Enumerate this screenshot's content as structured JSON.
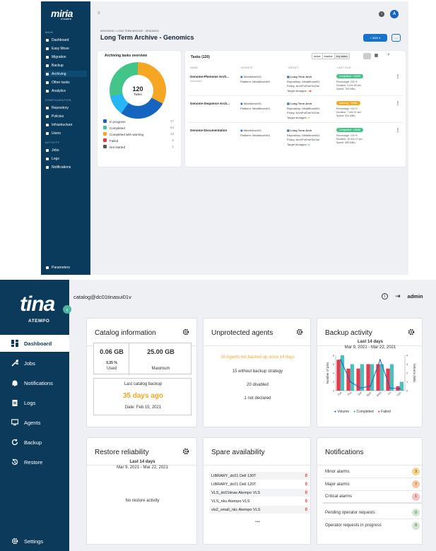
{
  "top": {
    "logo": "miria",
    "logo_sub": "ATEMPO",
    "avatar": "A",
    "sections": [
      "MAIN",
      "CONFIGURATION",
      "ACTIVITY"
    ],
    "menu_main": [
      "Dashboard",
      "Easy Move",
      "Migration",
      "Backup",
      "Archiving",
      "Other tasks",
      "Analytics"
    ],
    "menu_config": [
      "Repository",
      "Policies",
      "Infrastructure",
      "Users"
    ],
    "menu_activity": [
      "Jobs",
      "Logs",
      "Notifications"
    ],
    "params": "Parameters",
    "breadcrumb": "ARCHIVING > LONG TERM ARCHIVE - GENOMICS",
    "title": "Long Term Archive - Genomics",
    "add_label": "+ ADD ▾",
    "more_label": "...",
    "overview_title": "Archiving tasks overview",
    "donut_total": "120",
    "donut_label": "Tasks",
    "legend": [
      {
        "label": "In progress",
        "count": "37",
        "color": "#1565c0"
      },
      {
        "label": "Completed",
        "count": "64",
        "color": "#43c58a"
      },
      {
        "label": "Completed with warning",
        "count": "13",
        "color": "#f5a623"
      },
      {
        "label": "Failed",
        "count": "5",
        "color": "#e53935"
      },
      {
        "label": "Not started",
        "count": "1",
        "color": "#555555"
      }
    ],
    "tasks_title": "Tasks (120)",
    "filters": [
      "Active",
      "Inactive",
      "Any status"
    ],
    "columns": [
      "NAME",
      "SOURCE",
      "TARGET",
      "LAST RUN"
    ],
    "rows": [
      {
        "name": "Genome-Phenome Arch...",
        "sub": "Scheduled",
        "src1": "MiriaMove#01",
        "src2": "Platform: MiriaMove#01",
        "tgt1": "Long Term Arch",
        "tgt2": "Repository: MiriaMove#01",
        "tgt3": "Policy: ArchPolOneToOne",
        "tgt4": "Target storages:",
        "status": "Completed · 14h59",
        "scolor": "#43c58a",
        "l1": "Percentage: 100 %",
        "l2": "Duration: 3 min 59 sec",
        "l3": "Speed: 750 MB/s"
      },
      {
        "name": "Genome-Sequence Arch...",
        "sub": "",
        "src1": "MiriaMove#01",
        "src2": "Platform: MiriaMove#01",
        "tgt1": "Long Term Arch",
        "tgt2": "Repository: MiriaMove#01",
        "tgt3": "Policy: ArchPolOneToOne",
        "tgt4": "Target storages:",
        "status": "Warning · 11h58",
        "scolor": "#f5a623",
        "l1": "Percentage: 100 %",
        "l2": "Duration: 7 min 21 sec",
        "l3": "Speed: 534 MB/s"
      },
      {
        "name": "Genome-Documentation",
        "sub": "",
        "src1": "MiriaMove#01",
        "src2": "Platform: MiriaMove#01",
        "tgt1": "Long Term Arch",
        "tgt2": "Repository: MiriaMove#01",
        "tgt3": "Policy: ArchPolOneToOne",
        "tgt4": "Target storages:",
        "status": "Completed · 10h08",
        "scolor": "#43c58a",
        "l1": "Percentage: 100 %",
        "l2": "Duration: 13 min 17 sec",
        "l3": "Speed: 680 MB/s"
      }
    ]
  },
  "bottom": {
    "logo": "tina",
    "logo_sub": "ATEMPO",
    "host": "catalog@dc01tinasui01v",
    "user": "admin",
    "menu": [
      "Dashboard",
      "Jobs",
      "Notifications",
      "Logs",
      "Agents",
      "Backup",
      "Restore"
    ],
    "settings": "Settings",
    "catalog": {
      "title": "Catalog information",
      "used_value": "0.06 GB",
      "used_pct": "0.25 %",
      "used_label": "Used",
      "max_value": "25.00 GB",
      "max_label": "Maximum",
      "last_label": "Last catalog backup",
      "last_value": "35 days ago",
      "date": "Date: Feb 15, 2021"
    },
    "unprotected": {
      "title": "Unprotected agents",
      "warn": "26 Agents not backed up since 14 days",
      "l1": "15 without backup strategy",
      "l2": "20 disabled",
      "l3": "1 not declared"
    },
    "activity": {
      "title": "Backup activity",
      "period": "Last 14 days",
      "range": "Mar 9, 2021 - Mar 22, 2021",
      "ylabel": "Number of jobs",
      "y2label": "Volume (MB)",
      "legend": [
        "Volume",
        "Completed",
        "Failed"
      ]
    },
    "restore": {
      "title": "Restore reliability",
      "period": "Last 14 days",
      "range": "Mar 9, 2021 - Mar 22, 2021",
      "empty": "No restore activity"
    },
    "spare": {
      "title": "Spare availability",
      "rows": [
        {
          "name": "LIBRARY_dc01 Dell 130T",
          "val": "0"
        },
        {
          "name": "LIBRARY_dc01 Dell 120T",
          "val": "0"
        },
        {
          "name": "VLS_dc01tinas Atempo VLS",
          "val": "0"
        },
        {
          "name": "VLS_nko        Atempo VLS",
          "val": "0"
        },
        {
          "name": "vls2_small_nkc Atempo VLS",
          "val": "0"
        }
      ],
      "more": "..."
    },
    "notifications": {
      "title": "Notifications",
      "rows": [
        {
          "label": "Minor alarms",
          "val": "3",
          "color": "#f6d48a"
        },
        {
          "label": "Major alarms",
          "val": "7",
          "color": "#f8c9a0"
        },
        {
          "label": "Critical alarms",
          "val": "1",
          "color": "#f8c0c0"
        },
        {
          "label": "Pending operator requests",
          "val": "0",
          "color": "#cfe8d0"
        },
        {
          "label": "Operator requests in progress",
          "val": "0",
          "color": "#cfe8d0"
        }
      ]
    }
  },
  "chart_data": {
    "type": "bar",
    "categories": [
      "Tue",
      "Thu",
      "Sat",
      "Mon",
      "Wed",
      "Fri",
      "Sun"
    ],
    "series": [
      {
        "name": "Completed",
        "values": [
          8,
          6,
          6,
          6,
          6,
          6,
          2
        ]
      },
      {
        "name": "Failed",
        "values": [
          7,
          5,
          5,
          6,
          6,
          5,
          1
        ]
      },
      {
        "name": "Volume",
        "values": [
          3.5,
          1,
          0.3,
          0.5,
          3.5,
          0.3,
          0.2
        ]
      }
    ],
    "title": "Last 14 days",
    "subtitle": "Mar 9, 2021 - Mar 22, 2021",
    "ylabel": "Number of jobs",
    "y2label": "Volume (MB)",
    "ylim": [
      0,
      8
    ],
    "y2lim": [
      0,
      4
    ],
    "legend": "bottom"
  }
}
